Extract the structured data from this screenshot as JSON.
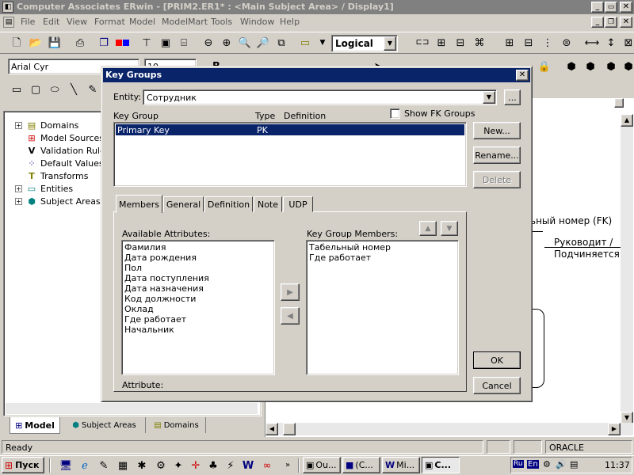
{
  "app": {
    "title": "Computer Associates ERwin - [PRIM2.ER1* : <Main Subject Area> / Display1]",
    "menu": [
      "File",
      "Edit",
      "View",
      "Format",
      "Model",
      "ModelMart",
      "Tools",
      "Window",
      "Help"
    ],
    "view_mode": "Logical",
    "font_name": "Arial Cyr",
    "font_size": "10",
    "status_ready": "Ready",
    "status_db": "ORACLE"
  },
  "tree": {
    "items": [
      {
        "label": "Domains",
        "icon": "domains-icon",
        "expandable": true
      },
      {
        "label": "Model Sources",
        "icon": "model-sources-icon",
        "expandable": false
      },
      {
        "label": "Validation Rules",
        "icon": "validation-rules-icon",
        "expandable": false
      },
      {
        "label": "Default Values",
        "icon": "default-values-icon",
        "expandable": false
      },
      {
        "label": "Transforms",
        "icon": "transforms-icon",
        "expandable": false
      },
      {
        "label": "Entities",
        "icon": "entities-icon",
        "expandable": true
      },
      {
        "label": "Subject Areas",
        "icon": "subject-areas-icon",
        "expandable": true
      }
    ],
    "tabs": [
      "Model",
      "Subject Areas",
      "Domains"
    ]
  },
  "canvas": {
    "fk_text": "ьный номер (FK)",
    "rel_line1": "Руководит /",
    "rel_line2": "Подчиняется"
  },
  "dialog": {
    "title": "Key Groups",
    "entity_label": "Entity:",
    "entity_value": "Сотрудник",
    "browse_label": "...",
    "col_key_group": "Key Group",
    "col_type": "Type",
    "col_definition": "Definition",
    "show_fk_label": "Show FK Groups",
    "show_fk_checked": false,
    "key_groups": [
      {
        "name": "Primary Key",
        "type": "PK",
        "definition": ""
      }
    ],
    "buttons": {
      "new": "New...",
      "rename": "Rename...",
      "delete": "Delete",
      "ok": "OK",
      "cancel": "Cancel"
    },
    "tabs": [
      "Members",
      "General",
      "Definition",
      "Note",
      "UDP"
    ],
    "active_tab": "Members",
    "available_label": "Available Attributes:",
    "available": [
      "Фамилия",
      "Дата рождения",
      "Пол",
      "Дата поступления",
      "Дата назначения",
      "Код должности",
      "Оклад",
      "Где работает",
      "Начальник"
    ],
    "members_label": "Key Group Members:",
    "members": [
      "Табельный номер",
      "Где работает"
    ],
    "attribute_label": "Attribute:"
  },
  "taskbar": {
    "start": "Пуск",
    "tasks": [
      "Ou...",
      "(С...",
      "Mi...",
      "С..."
    ],
    "lang": "En",
    "clock": "11:37"
  }
}
